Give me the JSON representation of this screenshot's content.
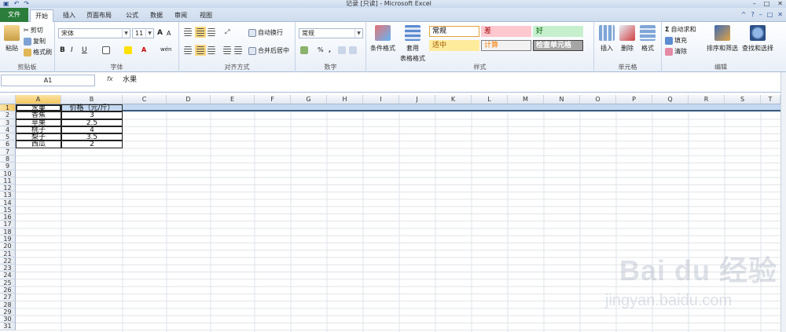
{
  "window": {
    "title": "记录 [只读] - Microsoft Excel",
    "quick_access": [
      "▣",
      "↶",
      "↷"
    ],
    "controls": [
      "–",
      "□",
      "✕"
    ]
  },
  "tabs": [
    "文件",
    "开始",
    "插入",
    "页面布局",
    "公式",
    "数据",
    "审阅",
    "视图"
  ],
  "active_tab": "开始",
  "help_icons": [
    "^",
    "?",
    "–",
    "□",
    "✕"
  ],
  "ribbon": {
    "clipboard": {
      "label": "剪贴板",
      "paste": "粘贴",
      "cut": "剪切",
      "copy": "复制",
      "format_painter": "格式刷"
    },
    "font": {
      "label": "字体",
      "name": "宋体",
      "size": "11",
      "bold": "B",
      "italic": "I",
      "underline": "U",
      "grow": "A",
      "shrink": "A",
      "wen": "wén"
    },
    "alignment": {
      "label": "对齐方式",
      "wrap": "自动换行",
      "merge": "合并后居中"
    },
    "number": {
      "label": "数字",
      "format": "常规",
      "percent": "%",
      "comma": ","
    },
    "styles": {
      "label": "样式",
      "conditional": "条件格式",
      "table_format_1": "套用",
      "table_format_2": "表格格式",
      "cells": [
        {
          "text": "常规",
          "bg": "#ffffff",
          "fg": "#000000",
          "border": "#e4a43b"
        },
        {
          "text": "差",
          "bg": "#ffc7ce",
          "fg": "#9c0006",
          "border": "#ffc7ce"
        },
        {
          "text": "好",
          "bg": "#c6efce",
          "fg": "#006100",
          "border": "#c6efce"
        },
        {
          "text": "适中",
          "bg": "#ffeb9c",
          "fg": "#9c5700",
          "border": "#ffeb9c"
        },
        {
          "text": "计算",
          "bg": "#f2f2f2",
          "fg": "#fa7d00",
          "border": "#7f7f7f"
        },
        {
          "text": "检查单元格",
          "bg": "#a5a5a5",
          "fg": "#ffffff",
          "border": "#3f3f3f"
        }
      ]
    },
    "cells_group": {
      "label": "单元格",
      "insert": "插入",
      "delete": "删除",
      "format": "格式"
    },
    "editing": {
      "label": "编辑",
      "autosum": "自动求和",
      "fill": "填充",
      "clear": "清除",
      "sort": "排序和筛选",
      "find": "查找和选择"
    }
  },
  "formula_bar": {
    "name_box": "A1",
    "fx": "fx",
    "content": "水果"
  },
  "columns": [
    "A",
    "B",
    "C",
    "D",
    "E",
    "F",
    "G",
    "H",
    "I",
    "J",
    "K",
    "L",
    "M",
    "N",
    "O",
    "P",
    "Q",
    "R",
    "S",
    "T"
  ],
  "rows": [
    "1",
    "2",
    "3",
    "4",
    "5",
    "6",
    "7",
    "8",
    "9",
    "10",
    "11",
    "12",
    "13",
    "14",
    "15",
    "16",
    "17",
    "18",
    "19",
    "20",
    "21",
    "22",
    "23",
    "24",
    "25",
    "26",
    "27",
    "28",
    "29",
    "30",
    "31"
  ],
  "table": {
    "header": [
      "水果",
      "价格（元/斤）"
    ],
    "data": [
      [
        "香蕉",
        "3"
      ],
      [
        "苹果",
        "2.5"
      ],
      [
        "桃子",
        "4"
      ],
      [
        "梨子",
        "3.5"
      ],
      [
        "西瓜",
        "2"
      ]
    ]
  },
  "watermark": {
    "main": "Bai du 经验",
    "sub": "jingyan.baidu.com"
  }
}
